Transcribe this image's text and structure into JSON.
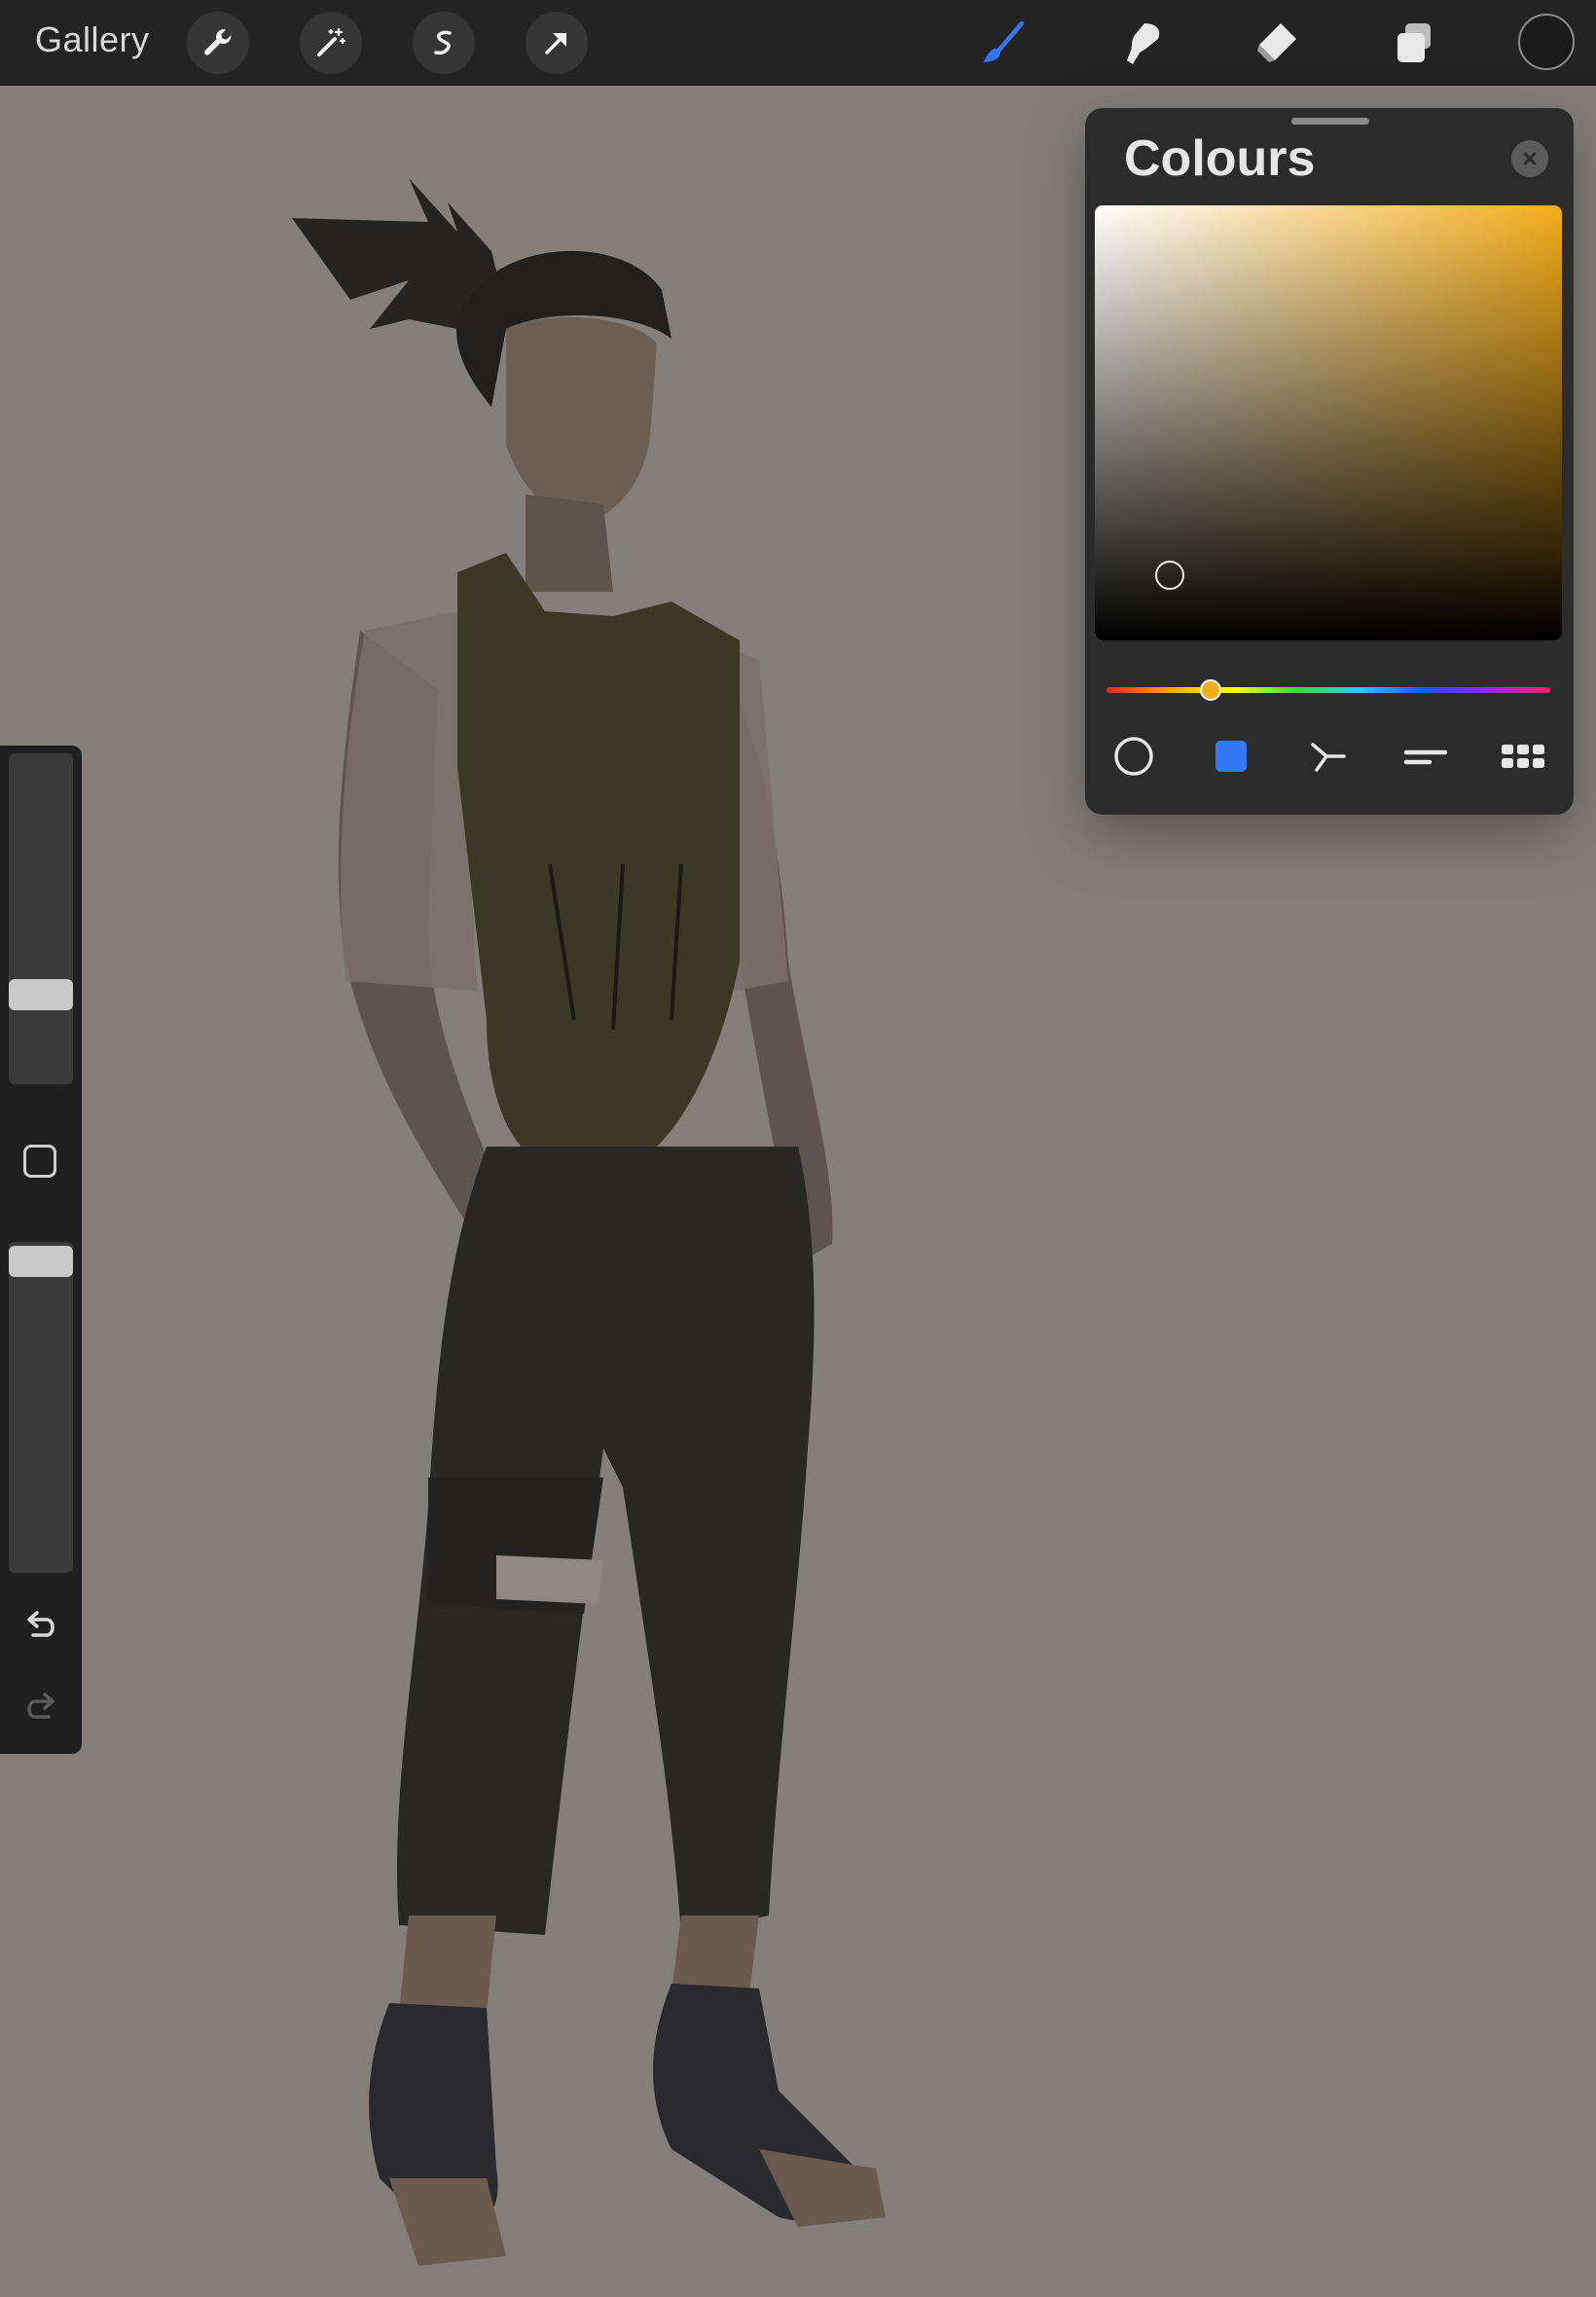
{
  "toolbar": {
    "gallery_label": "Gallery",
    "left_tools": [
      "wrench-icon",
      "magic-wand-icon",
      "selection-icon",
      "transform-arrow-icon"
    ],
    "right_tools": [
      "brush-icon",
      "smudge-icon",
      "eraser-icon",
      "layers-icon"
    ],
    "active_tool": "brush-icon",
    "current_color": "#1b1b1b",
    "accent_color": "#3478f6"
  },
  "sidebar": {
    "brush_size_level": 0.2,
    "opacity_level": 1.0,
    "icons": [
      "modify-button",
      "undo-icon",
      "redo-icon"
    ]
  },
  "colours_panel": {
    "title": "Colours",
    "hue_color": "#f4ad1c",
    "hue_position": 0.1,
    "tabs": [
      "disc-icon",
      "classic-square-icon",
      "harmony-icon",
      "value-sliders-icon",
      "palettes-grid-icon"
    ],
    "active_tab": "classic-square-icon"
  }
}
